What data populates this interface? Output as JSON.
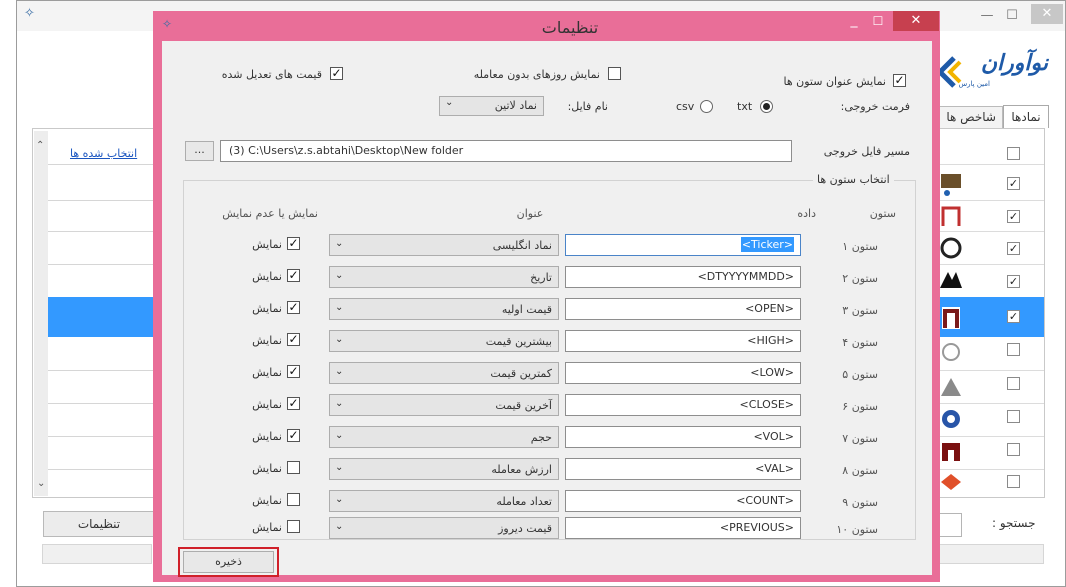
{
  "background": {
    "left_link": "انتخاب شده ها",
    "settings_button": "تنظیمات",
    "tabs": [
      "نمادها",
      "شاخص ها"
    ],
    "search_label": "جستجو :",
    "logo_text": "نوآوران",
    "logo_sub": "امین پارس",
    "checkbox_states": [
      false,
      true,
      true,
      true,
      true,
      true,
      false,
      false,
      false,
      false
    ]
  },
  "dialog": {
    "title": "تنظیمات",
    "options": {
      "show_headers": {
        "label": "نمایش عنوان ستون ها",
        "checked": true
      },
      "no_trade_days": {
        "label": "نمایش روزهای بدون معامله",
        "checked": false
      },
      "adjusted_prices": {
        "label": "قیمت های تعدیل شده",
        "checked": true
      }
    },
    "output_format": {
      "label": "فرمت خروجی:",
      "txt": "txt",
      "csv": "csv",
      "selected": "txt"
    },
    "file_name": {
      "label": "نام فایل:",
      "value": "نماد لاتین"
    },
    "output_path": {
      "label": "مسیر فایل خروجی",
      "browse": "...",
      "value": "(3) C:\\Users\\z.s.abtahi\\Desktop\\New folder"
    },
    "columns_group": {
      "label": "انتخاب ستون ها",
      "header_column": "ستون",
      "header_data": "داده",
      "header_title": "عنوان",
      "header_show": "نمایش یا عدم نمایش",
      "rows": [
        {
          "col": "ستون ۱",
          "data": "<Ticker>",
          "title": "نماد انگلیسی",
          "show": true,
          "show_label": "نمایش"
        },
        {
          "col": "ستون ۲",
          "data": "<DTYYYYMMDD>",
          "title": "تاریخ",
          "show": true,
          "show_label": "نمایش"
        },
        {
          "col": "ستون ۳",
          "data": "<OPEN>",
          "title": "قیمت اولیه",
          "show": true,
          "show_label": "نمایش"
        },
        {
          "col": "ستون ۴",
          "data": "<HIGH>",
          "title": "بیشترین قیمت",
          "show": true,
          "show_label": "نمایش"
        },
        {
          "col": "ستون ۵",
          "data": "<LOW>",
          "title": "کمترین قیمت",
          "show": true,
          "show_label": "نمایش"
        },
        {
          "col": "ستون ۶",
          "data": "<CLOSE>",
          "title": "آخرین قیمت",
          "show": true,
          "show_label": "نمایش"
        },
        {
          "col": "ستون ۷",
          "data": "<VOL>",
          "title": "حجم",
          "show": true,
          "show_label": "نمایش"
        },
        {
          "col": "ستون ۸",
          "data": "<VAL>",
          "title": "ارزش معامله",
          "show": false,
          "show_label": "نمایش"
        },
        {
          "col": "ستون ۹",
          "data": "<COUNT>",
          "title": "تعداد معامله",
          "show": false,
          "show_label": "نمایش"
        },
        {
          "col": "ستون ۱۰",
          "data": "<PREVIOUS>",
          "title": "قیمت دیروز",
          "show": false,
          "show_label": "نمایش"
        }
      ]
    },
    "save_button": "ذخیره"
  }
}
